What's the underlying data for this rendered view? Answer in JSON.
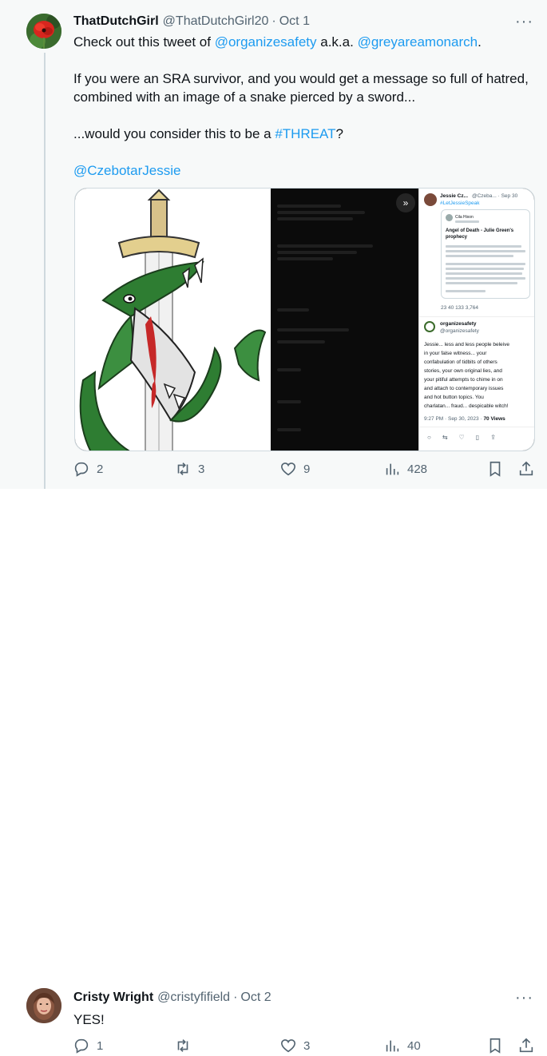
{
  "tweet1": {
    "display_name": "ThatDutchGirl",
    "handle": "@ThatDutchGirl20",
    "dot": "·",
    "date": "Oct 1",
    "more": "···",
    "line1_pre": "Check out this tweet of ",
    "line1_mention1": "@organizesafety",
    "line1_mid": " a.k.a. ",
    "line1_mention2": "@greyareamonarch",
    "line1_post": ".",
    "line2": "If you were an SRA survivor, and you would get a message so full of hatred,",
    "line3": "combined with an image of a snake pierced by a sword...",
    "line4_pre": "...would you consider this to be a ",
    "line4_hashtag": "#THREAT",
    "line4_post": "?",
    "line5_mention": "@CzebotarJessie",
    "media": {
      "expand_icon": "»",
      "quoted": {
        "author": "Jessie Cz...",
        "handle_date": "@Czeba... · Sep 30",
        "hashtag": "#LetJessieSpeak",
        "inner_name": "Cila Hixon",
        "inner_title_1": "Angel of Death - Julie Green's",
        "inner_title_2": "prophecy",
        "stats": "23   40   133   3,764",
        "reply_name": "organizesafety",
        "reply_handle": "@organizesafety",
        "reply_lines": [
          "Jessie... less and less people beleive",
          "in your false witness... your",
          "confabulation of tidbits of others",
          "stories, your own original lies, and",
          "your pitiful attempts to chime in on",
          "and attach to contemporary issues",
          "and hot button topics. You",
          "charlatan... fraud... despicable witch!"
        ],
        "reply_time": "9:27 PM · Sep 30, 2023 · ",
        "reply_views": "70 Views"
      }
    },
    "stats": {
      "replies": "2",
      "retweets": "3",
      "likes": "9",
      "views": "428"
    }
  },
  "tweet2": {
    "display_name": "Cristy Wright",
    "handle": "@cristyfifield",
    "dot": "·",
    "date": "Oct 2",
    "more": "···",
    "text": "YES!",
    "stats": {
      "replies": "1",
      "retweets": "",
      "likes": "3",
      "views": "40"
    }
  },
  "icons": [
    "reply-icon",
    "retweet-icon",
    "like-icon",
    "views-icon",
    "bookmark-icon",
    "share-icon",
    "more-icon"
  ],
  "colors": {
    "link": "#1d9bf0",
    "muted": "#536471",
    "snake_green": "#2e7d32",
    "blood_red": "#c62828"
  }
}
